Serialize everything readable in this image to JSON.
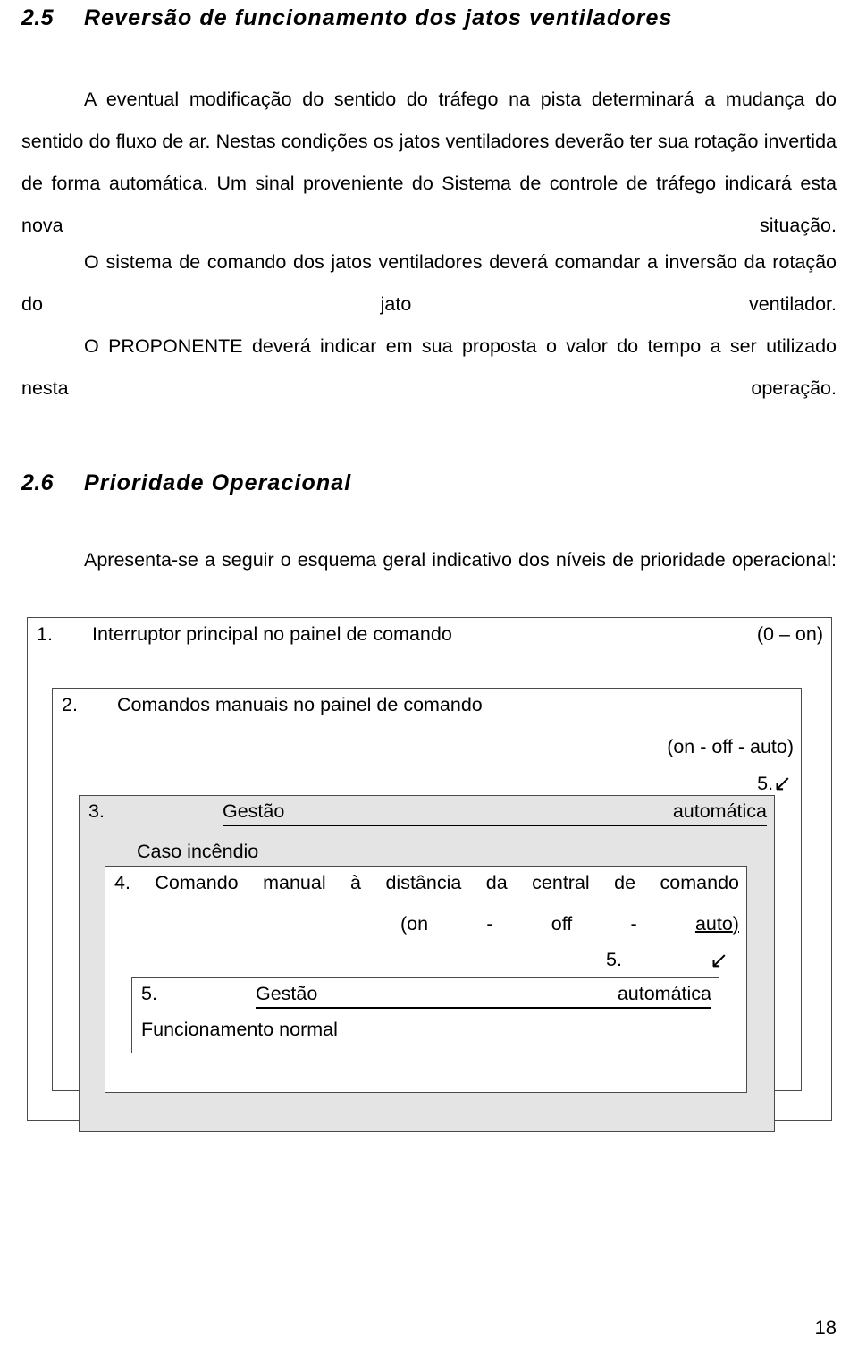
{
  "document": {
    "page_number": "18",
    "sections": [
      {
        "number": "2.5",
        "title": "Reversão de funcionamento dos jatos ventiladores"
      },
      {
        "number": "2.6",
        "title": "Prioridade Operacional"
      }
    ],
    "paragraphs": {
      "p1": "A eventual modificação do sentido do tráfego na pista determinará a mudança do sentido do fluxo de ar. Nestas condições os jatos ventiladores deverão ter sua rotação invertida de forma automática. Um sinal proveniente do Sistema de controle de tráfego indicará esta nova situação.",
      "p2": "O sistema de comando dos jatos ventiladores deverá comandar a inversão da rotação do jato ventilador.",
      "p3": "O PROPONENTE deverá indicar em sua proposta o valor do tempo a ser utilizado nesta operação.",
      "p4": "Apresenta-se a seguir o esquema geral indicativo dos níveis de prioridade operacional:"
    },
    "priority_scheme": {
      "level1": {
        "index": "1.",
        "label": "Interruptor principal no painel de comando",
        "states": "(0 – on)"
      },
      "level2": {
        "index": "2.",
        "label": "Comandos manuais no painel de comando",
        "states": "(on - off - auto)",
        "next_ref": "5.",
        "arrow": "down-left-arrow-icon"
      },
      "level3": {
        "index": "3.",
        "title_left": "Gestão",
        "title_right": "automática",
        "label": "Caso incêndio"
      },
      "level4": {
        "index": "4.",
        "label_words": [
          "Comando",
          "manual",
          "à",
          "distância",
          "da",
          "central",
          "de",
          "comando"
        ],
        "states_prefix": "(on",
        "states_sep1": "-",
        "states_mid": "off",
        "states_sep2": "-",
        "states_auto": "auto",
        "states_suffix": ")",
        "next_ref": "5.",
        "arrow": "down-left-arrow-icon"
      },
      "level5": {
        "index": "5.",
        "title_left": "Gestão",
        "title_right": "automática",
        "label": "Funcionamento normal"
      }
    }
  }
}
